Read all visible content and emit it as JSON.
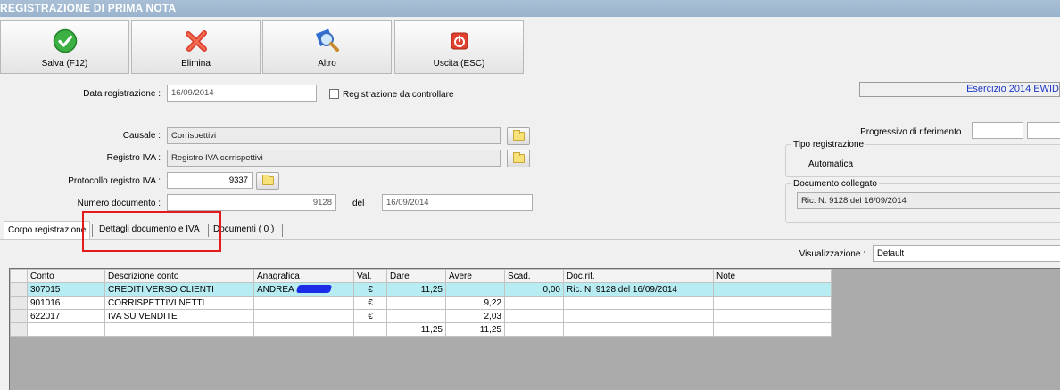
{
  "window": {
    "title": "REGISTRAZIONE DI PRIMA NOTA"
  },
  "toolbar": {
    "save_label": "Salva (F12)",
    "delete_label": "Elimina",
    "other_label": "Altro",
    "exit_label": "Uscita (ESC)"
  },
  "form": {
    "data_registrazione_label": "Data registrazione :",
    "data_registrazione": "16/09/2014",
    "da_controllare_label": "Registrazione da controllare",
    "esercizio": "Esercizio 2014 EWID",
    "causale_label": "Causale :",
    "causale": "Corrispettivi",
    "registro_iva_label": "Registro IVA :",
    "registro_iva": "Registro IVA corrispettivi",
    "protocollo_label": "Protocollo registro IVA :",
    "protocollo": "9337",
    "numero_documento_label": "Numero documento :",
    "numero_documento": "9128",
    "del_label": "del",
    "data_documento": "16/09/2014",
    "progressivo_label": "Progressivo di riferimento :",
    "tipo_registrazione_legend": "Tipo registrazione",
    "tipo_registrazione": "Automatica",
    "documento_collegato_legend": "Documento collegato",
    "documento_collegato": "Ric. N. 9128 del 16/09/2014"
  },
  "tabs": [
    {
      "label": "Corpo registrazione"
    },
    {
      "label": "Dettagli documento e IVA"
    },
    {
      "label": "Documenti ( 0 )"
    }
  ],
  "visualizzazione": {
    "label": "Visualizzazione :",
    "value": "Default"
  },
  "grid": {
    "headers": [
      "Conto",
      "Descrizione conto",
      "Anagrafica",
      "Val.",
      "Dare",
      "Avere",
      "Scad.",
      "Doc.rif.",
      "Note"
    ],
    "rows": [
      {
        "conto": "307015",
        "descrizione": "CREDITI VERSO CLIENTI",
        "anagrafica": "ANDREA",
        "val": "€",
        "dare": "11,25",
        "avere": "",
        "scad": "0,00",
        "docrif": "Ric. N. 9128 del 16/09/2014",
        "note": ""
      },
      {
        "conto": "901016",
        "descrizione": "CORRISPETTIVI NETTI",
        "anagrafica": "",
        "val": "€",
        "dare": "",
        "avere": "9,22",
        "scad": "",
        "docrif": "",
        "note": ""
      },
      {
        "conto": "622017",
        "descrizione": "IVA SU VENDITE",
        "anagrafica": "",
        "val": "€",
        "dare": "",
        "avere": "2,03",
        "scad": "",
        "docrif": "",
        "note": ""
      }
    ],
    "totals": {
      "dare": "11,25",
      "avere": "11,25"
    }
  },
  "colors": {
    "titlebar": "#9ab3cd",
    "highlight_row": "#b7ecf3",
    "annotation": "#e11b1b"
  }
}
